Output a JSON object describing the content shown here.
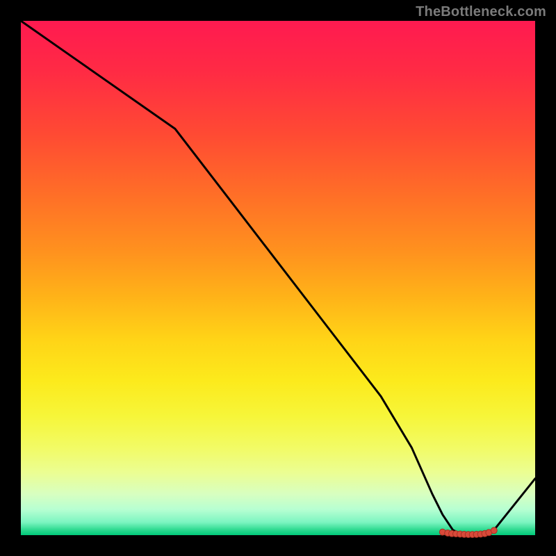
{
  "watermark": "TheBottleneck.com",
  "colors": {
    "frame": "#000000",
    "line": "#000000",
    "marker_fill": "#d84a3a",
    "marker_stroke": "#a82f22",
    "gradient_top": "#ff1a50",
    "gradient_bottom": "#00c97a"
  },
  "chart_data": {
    "type": "line",
    "title": "",
    "xlabel": "",
    "ylabel": "",
    "xlim": [
      0,
      100
    ],
    "ylim": [
      0,
      100
    ],
    "grid": false,
    "series": [
      {
        "name": "bottleneck-curve",
        "x": [
          0,
          10,
          20,
          30,
          40,
          50,
          60,
          70,
          76,
          80,
          82,
          84,
          86,
          88,
          90,
          92,
          100
        ],
        "y": [
          100,
          93,
          86,
          79,
          66,
          53,
          40,
          27,
          17,
          8,
          4,
          1,
          0,
          0,
          0,
          1,
          11
        ]
      }
    ],
    "markers": {
      "name": "optimal-range",
      "x": [
        82.0,
        83.0,
        83.8,
        84.6,
        85.4,
        86.2,
        87.0,
        87.8,
        88.6,
        89.4,
        90.2,
        91.0,
        92.0
      ],
      "y": [
        0.6,
        0.4,
        0.3,
        0.25,
        0.2,
        0.15,
        0.12,
        0.12,
        0.15,
        0.2,
        0.3,
        0.5,
        0.9
      ]
    }
  }
}
